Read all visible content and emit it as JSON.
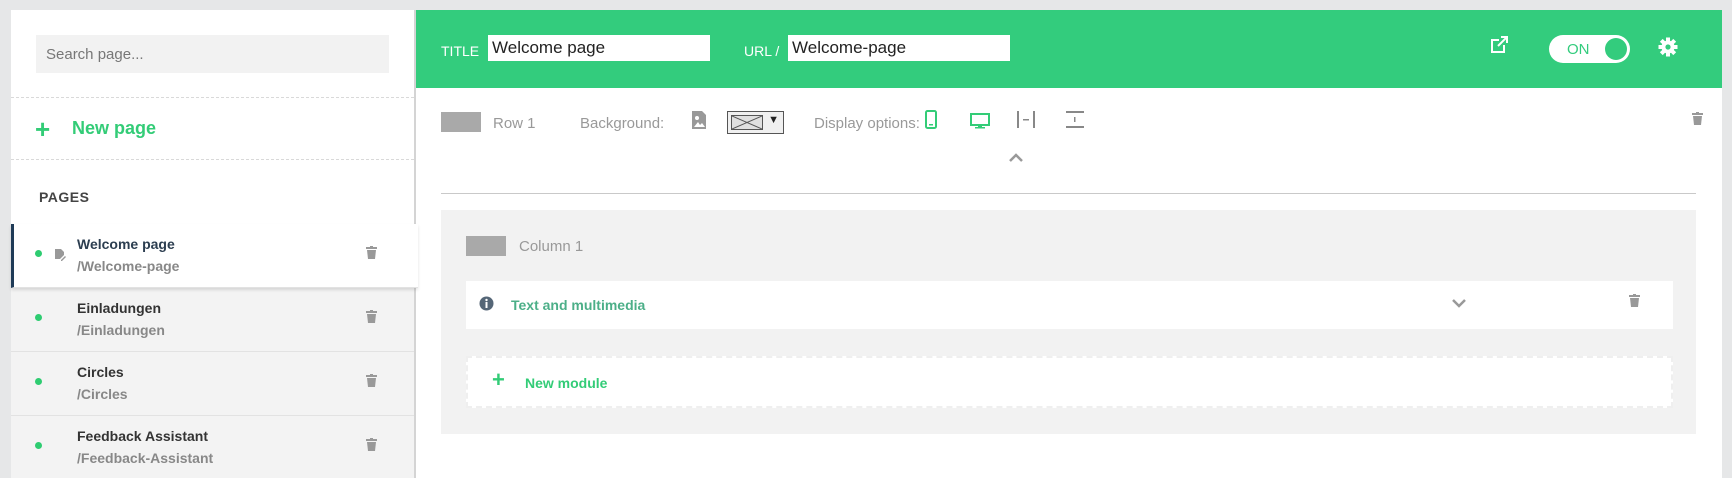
{
  "sidebar": {
    "search_placeholder": "Search page...",
    "new_page_label": "New page",
    "pages_heading": "PAGES",
    "pages": [
      {
        "title": "Welcome page",
        "url": "/Welcome-page"
      },
      {
        "title": "Einladungen",
        "url": "/Einladungen"
      },
      {
        "title": "Circles",
        "url": "/Circles"
      },
      {
        "title": "Feedback Assistant",
        "url": "/Feedback-Assistant"
      }
    ]
  },
  "header": {
    "title_label": "TITLE",
    "title_value": "Welcome page",
    "url_label": "URL /",
    "url_value": "Welcome-page",
    "toggle_label": "ON",
    "accent_color": "#33cc7d"
  },
  "row": {
    "label": "Row 1",
    "background_label": "Background:",
    "display_label": "Display options:"
  },
  "column": {
    "label": "Column 1",
    "module_label": "Text and multimedia",
    "new_module_label": "New module"
  },
  "icons": {
    "external": "external-link-icon",
    "settings": "gear-icon",
    "trash": "trash-icon",
    "image": "image-icon",
    "mobile": "mobile-icon",
    "desktop": "desktop-icon",
    "width": "full-width-icon",
    "height": "full-height-icon",
    "info": "info-icon"
  }
}
